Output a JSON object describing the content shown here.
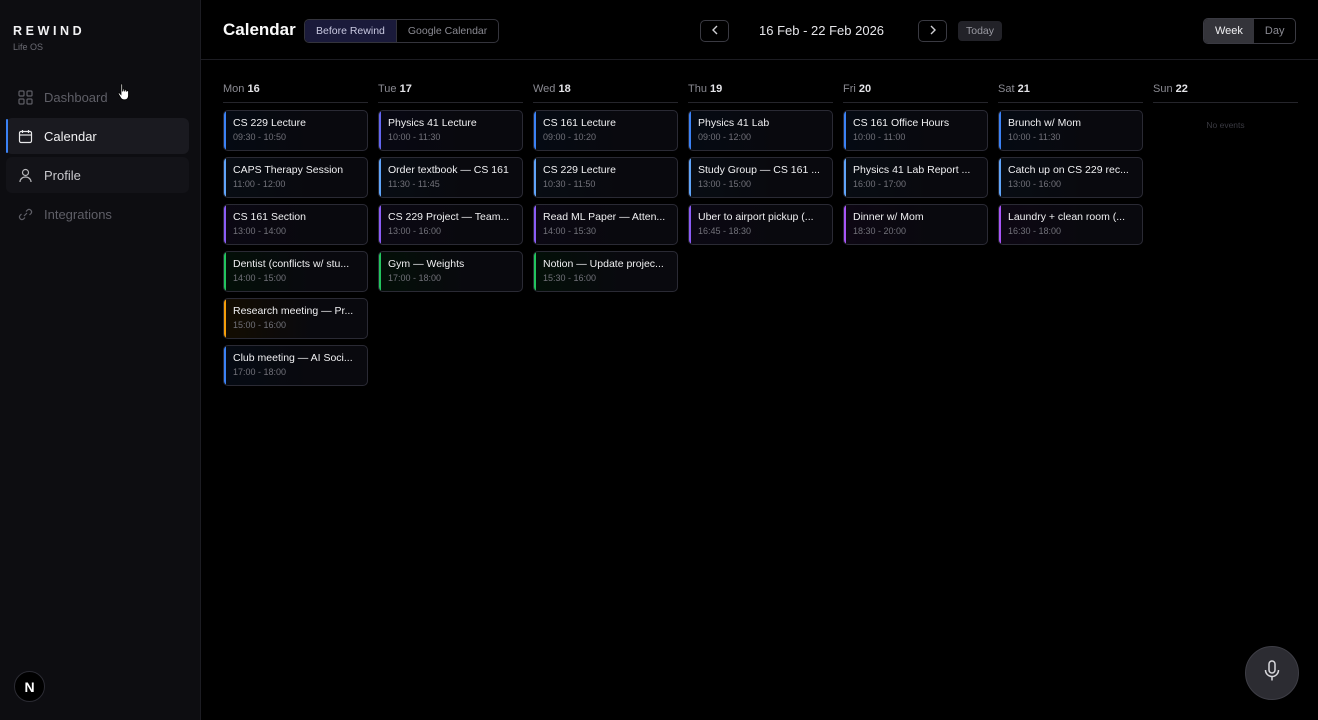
{
  "brand": {
    "name": "REWIND",
    "subtitle": "Life OS"
  },
  "sidebar": {
    "items": [
      {
        "label": "Dashboard",
        "icon": "grid-icon"
      },
      {
        "label": "Calendar",
        "icon": "calendar-icon"
      },
      {
        "label": "Profile",
        "icon": "user-icon"
      },
      {
        "label": "Integrations",
        "icon": "link-icon"
      }
    ],
    "avatar_letter": "N"
  },
  "header": {
    "title": "Calendar",
    "source_tabs": [
      "Before Rewind",
      "Google Calendar"
    ],
    "date_range": "16 Feb - 22 Feb 2026",
    "today_label": "Today",
    "view_tabs": [
      "Week",
      "Day"
    ]
  },
  "colors": {
    "blue": "#3b82f6",
    "purple": "#8b5cf6",
    "magenta": "#a855f7",
    "green": "#22c55e",
    "orange": "#f59e0b",
    "sky": "#60a5fa"
  },
  "days": [
    {
      "dow": "Mon",
      "date": "16",
      "events": [
        {
          "title": "CS 229 Lecture",
          "time": "09:30 - 10:50",
          "color": "#3b82f6"
        },
        {
          "title": "CAPS Therapy Session",
          "time": "11:00 - 12:00",
          "color": "#60a5fa"
        },
        {
          "title": "CS 161 Section",
          "time": "13:00 - 14:00",
          "color": "#8b5cf6"
        },
        {
          "title": "Dentist (conflicts w/ stu...",
          "time": "14:00 - 15:00",
          "color": "#22c55e"
        },
        {
          "title": "Research meeting — Pr...",
          "time": "15:00 - 16:00",
          "color": "#f59e0b"
        },
        {
          "title": "Club meeting — AI Soci...",
          "time": "17:00 - 18:00",
          "color": "#3b82f6"
        }
      ]
    },
    {
      "dow": "Tue",
      "date": "17",
      "events": [
        {
          "title": "Physics 41 Lecture",
          "time": "10:00 - 11:30",
          "color": "#6366f1"
        },
        {
          "title": "Order textbook — CS 161",
          "time": "11:30 - 11:45",
          "color": "#60a5fa"
        },
        {
          "title": "CS 229 Project — Team...",
          "time": "13:00 - 16:00",
          "color": "#8b5cf6"
        },
        {
          "title": "Gym — Weights",
          "time": "17:00 - 18:00",
          "color": "#22c55e"
        }
      ]
    },
    {
      "dow": "Wed",
      "date": "18",
      "events": [
        {
          "title": "CS 161 Lecture",
          "time": "09:00 - 10:20",
          "color": "#3b82f6"
        },
        {
          "title": "CS 229 Lecture",
          "time": "10:30 - 11:50",
          "color": "#60a5fa"
        },
        {
          "title": "Read ML Paper — Atten...",
          "time": "14:00 - 15:30",
          "color": "#8b5cf6"
        },
        {
          "title": "Notion — Update projec...",
          "time": "15:30 - 16:00",
          "color": "#22c55e"
        }
      ]
    },
    {
      "dow": "Thu",
      "date": "19",
      "events": [
        {
          "title": "Physics 41 Lab",
          "time": "09:00 - 12:00",
          "color": "#3b82f6"
        },
        {
          "title": "Study Group — CS 161 ...",
          "time": "13:00 - 15:00",
          "color": "#60a5fa"
        },
        {
          "title": "Uber to airport pickup (...",
          "time": "16:45 - 18:30",
          "color": "#8b5cf6"
        }
      ]
    },
    {
      "dow": "Fri",
      "date": "20",
      "events": [
        {
          "title": "CS 161 Office Hours",
          "time": "10:00 - 11:00",
          "color": "#3b82f6"
        },
        {
          "title": "Physics 41 Lab Report ...",
          "time": "16:00 - 17:00",
          "color": "#60a5fa"
        },
        {
          "title": "Dinner w/ Mom",
          "time": "18:30 - 20:00",
          "color": "#a855f7"
        }
      ]
    },
    {
      "dow": "Sat",
      "date": "21",
      "events": [
        {
          "title": "Brunch w/ Mom",
          "time": "10:00 - 11:30",
          "color": "#3b82f6"
        },
        {
          "title": "Catch up on CS 229 rec...",
          "time": "13:00 - 16:00",
          "color": "#60a5fa"
        },
        {
          "title": "Laundry + clean room (...",
          "time": "16:30 - 18:00",
          "color": "#a855f7"
        }
      ]
    },
    {
      "dow": "Sun",
      "date": "22",
      "events": [],
      "empty_label": "No events"
    }
  ]
}
